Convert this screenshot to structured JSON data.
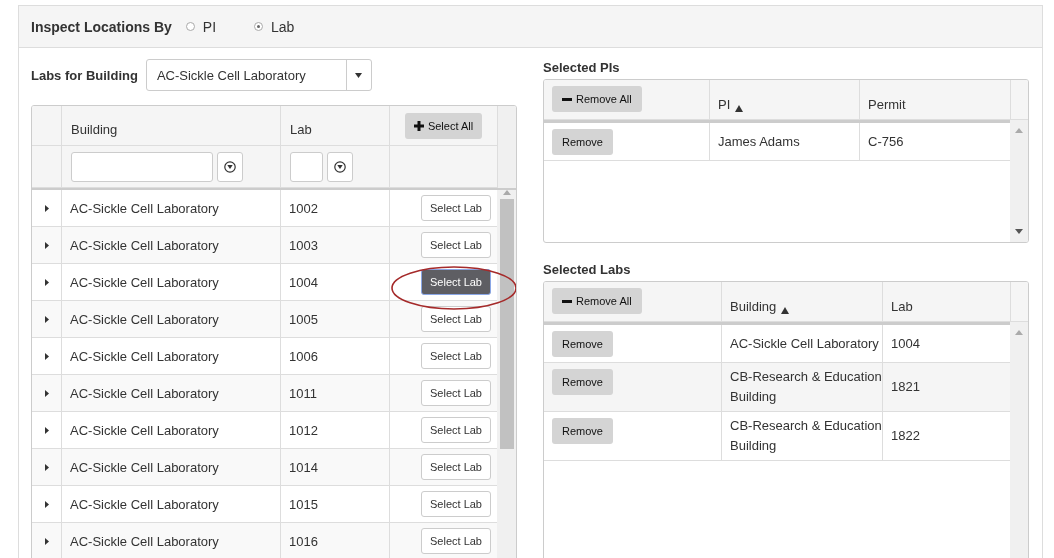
{
  "inspect_by": {
    "label": "Inspect Locations By",
    "options": [
      {
        "label": "PI",
        "selected": false
      },
      {
        "label": "Lab",
        "selected": true
      }
    ]
  },
  "building_picker": {
    "label": "Labs for Building",
    "value": "AC-Sickle Cell Laboratory"
  },
  "labs_grid": {
    "columns": [
      {
        "label": "Building"
      },
      {
        "label": "Lab"
      }
    ],
    "select_all": "Select All",
    "rows": [
      {
        "building": "AC-Sickle Cell Laboratory",
        "lab": "1002",
        "action": "Select Lab",
        "selected": false
      },
      {
        "building": "AC-Sickle Cell Laboratory",
        "lab": "1003",
        "action": "Select Lab",
        "selected": false
      },
      {
        "building": "AC-Sickle Cell Laboratory",
        "lab": "1004",
        "action": "Select Lab",
        "selected": true
      },
      {
        "building": "AC-Sickle Cell Laboratory",
        "lab": "1005",
        "action": "Select Lab",
        "selected": false
      },
      {
        "building": "AC-Sickle Cell Laboratory",
        "lab": "1006",
        "action": "Select Lab",
        "selected": false
      },
      {
        "building": "AC-Sickle Cell Laboratory",
        "lab": "1011",
        "action": "Select Lab",
        "selected": false
      },
      {
        "building": "AC-Sickle Cell Laboratory",
        "lab": "1012",
        "action": "Select Lab",
        "selected": false
      },
      {
        "building": "AC-Sickle Cell Laboratory",
        "lab": "1014",
        "action": "Select Lab",
        "selected": false
      },
      {
        "building": "AC-Sickle Cell Laboratory",
        "lab": "1015",
        "action": "Select Lab",
        "selected": false
      },
      {
        "building": "AC-Sickle Cell Laboratory",
        "lab": "1016",
        "action": "Select Lab",
        "selected": false
      }
    ]
  },
  "selected_pis": {
    "title": "Selected PIs",
    "remove_all": "Remove All",
    "columns": [
      {
        "label": "PI",
        "sorted": true
      },
      {
        "label": "Permit",
        "sorted": false
      }
    ],
    "rows": [
      {
        "action": "Remove",
        "cells": [
          "James Adams",
          "C-756"
        ]
      }
    ]
  },
  "selected_labs": {
    "title": "Selected Labs",
    "remove_all": "Remove All",
    "columns": [
      {
        "label": "Building",
        "sorted": true
      },
      {
        "label": "Lab",
        "sorted": false
      }
    ],
    "rows": [
      {
        "action": "Remove",
        "cells": [
          "AC-Sickle Cell Laboratory",
          "1004"
        ]
      },
      {
        "action": "Remove",
        "cells": [
          "CB-Research & Education Building",
          "1821"
        ]
      },
      {
        "action": "Remove",
        "cells": [
          "CB-Research & Education Building",
          "1822"
        ]
      }
    ]
  }
}
